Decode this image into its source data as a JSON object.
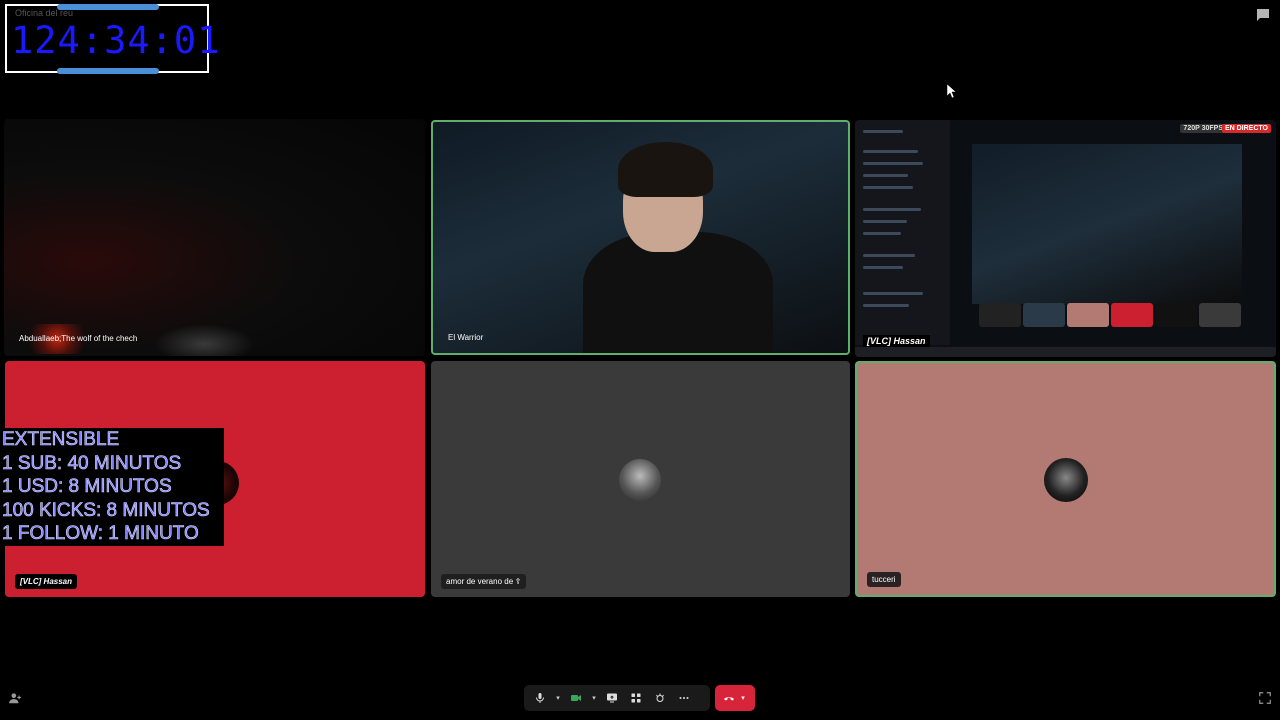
{
  "timer": {
    "channel": "Oficina del reu",
    "time": "124:34:01"
  },
  "tiles": {
    "t1": {
      "name": "Abduallaeb;The wolf of the chech"
    },
    "t2": {
      "name": "El Warrior"
    },
    "t3": {
      "resolution_badge": "720P 30FPS",
      "live_badge": "EN DIRECTO",
      "name": "[VLC] Hassan"
    },
    "t4": {
      "name": "[VLC] Hassan"
    },
    "t5": {
      "name": "amor de verano de ☦"
    },
    "t6": {
      "name": "tucceri"
    }
  },
  "overlay": {
    "lines": [
      "EXTENSIBLE",
      "1 SUB: 40 MINUTOS",
      "1 USD: 8 MINUTOS",
      "100 KICKS: 8 MINUTOS",
      "1 FOLLOW: 1 MINUTO"
    ]
  },
  "colors": {
    "speaking_border": "#5fae6b",
    "hangup": "#d8243a",
    "timer_text": "#1a1aff"
  },
  "icons": [
    "mic-icon",
    "camera-icon",
    "screen-share-icon",
    "activities-icon",
    "soundboard-icon",
    "more-icon",
    "hang-up-icon",
    "chat-icon",
    "invite-icon",
    "fullscreen-icon"
  ]
}
